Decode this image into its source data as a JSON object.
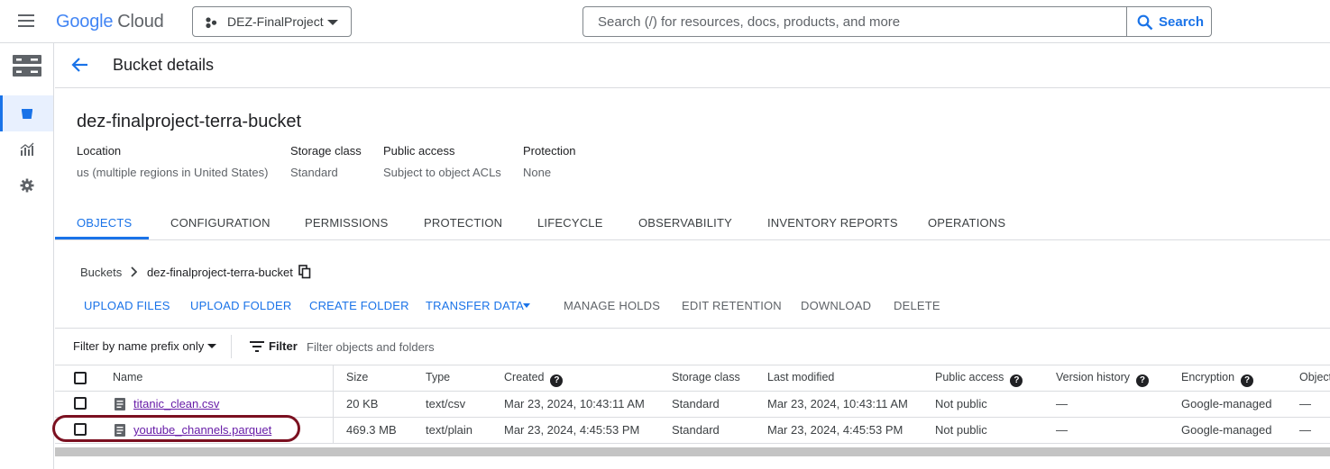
{
  "topbar": {
    "logo_google": "Google",
    "logo_cloud": "Cloud",
    "project_name": "DEZ-FinalProject",
    "search_placeholder": "Search (/) for resources, docs, products, and more",
    "search_button": "Search"
  },
  "header": {
    "title": "Bucket details"
  },
  "bucket": {
    "name": "dez-finalproject-terra-bucket",
    "properties": [
      {
        "label": "Location",
        "value": "us (multiple regions in United States)"
      },
      {
        "label": "Storage class",
        "value": "Standard"
      },
      {
        "label": "Public access",
        "value": "Subject to object ACLs"
      },
      {
        "label": "Protection",
        "value": "None"
      }
    ]
  },
  "tabs": [
    {
      "label": "OBJECTS",
      "active": true
    },
    {
      "label": "CONFIGURATION"
    },
    {
      "label": "PERMISSIONS"
    },
    {
      "label": "PROTECTION"
    },
    {
      "label": "LIFECYCLE"
    },
    {
      "label": "OBSERVABILITY"
    },
    {
      "label": "INVENTORY REPORTS"
    },
    {
      "label": "OPERATIONS"
    }
  ],
  "breadcrumb": {
    "root": "Buckets",
    "current": "dez-finalproject-terra-bucket"
  },
  "actions": [
    {
      "label": "UPLOAD FILES",
      "enabled": true
    },
    {
      "label": "UPLOAD FOLDER",
      "enabled": true
    },
    {
      "label": "CREATE FOLDER",
      "enabled": true
    },
    {
      "label": "TRANSFER DATA",
      "enabled": true
    },
    {
      "label": "MANAGE HOLDS",
      "enabled": false
    },
    {
      "label": "EDIT RETENTION",
      "enabled": false
    },
    {
      "label": "DOWNLOAD",
      "enabled": false
    },
    {
      "label": "DELETE",
      "enabled": false
    }
  ],
  "filter": {
    "prefix_label": "Filter by name prefix only",
    "filter_label": "Filter",
    "placeholder": "Filter objects and folders"
  },
  "table": {
    "headers": [
      "Name",
      "Size",
      "Type",
      "Created",
      "Storage class",
      "Last modified",
      "Public access",
      "Version history",
      "Encryption",
      "Object"
    ],
    "rows": [
      {
        "name": "titanic_clean.csv",
        "size": "20 KB",
        "type": "text/csv",
        "created": "Mar 23, 2024, 10:43:11 AM",
        "storage_class": "Standard",
        "last_modified": "Mar 23, 2024, 10:43:11 AM",
        "public_access": "Not public",
        "version_history": "—",
        "encryption": "Google-managed",
        "object": "—"
      },
      {
        "name": "youtube_channels.parquet",
        "size": "469.3 MB",
        "type": "text/plain",
        "created": "Mar 23, 2024, 4:45:53 PM",
        "storage_class": "Standard",
        "last_modified": "Mar 23, 2024, 4:45:53 PM",
        "public_access": "Not public",
        "version_history": "—",
        "encryption": "Google-managed",
        "object": "—"
      }
    ]
  },
  "colors": {
    "accent": "#1a73e8",
    "visited_link": "#681da8",
    "highlight_oval": "#7b1020"
  }
}
